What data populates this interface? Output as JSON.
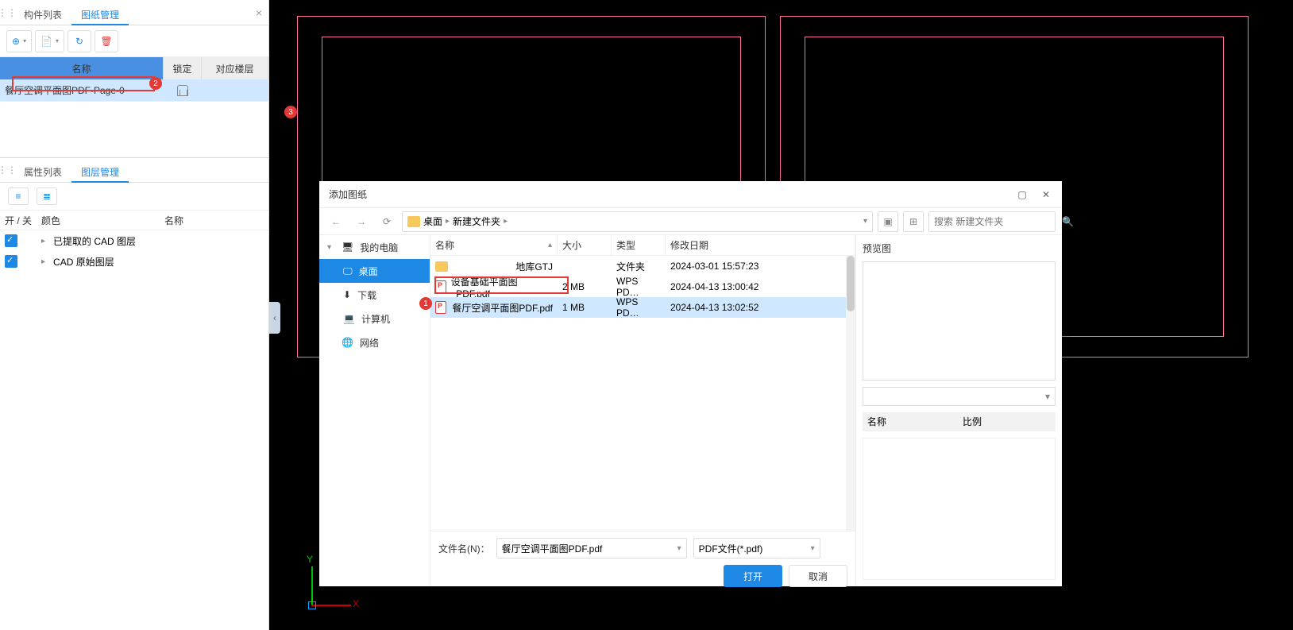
{
  "left": {
    "tabs": [
      "构件列表",
      "图纸管理"
    ],
    "drawingGrid": {
      "headers": {
        "name": "名称",
        "lock": "锁定",
        "floor": "对应楼层"
      },
      "row": {
        "name": "餐厅空调平面图PDF-Page-0"
      }
    },
    "tabs2": [
      "属性列表",
      "图层管理"
    ],
    "layerHeaders": {
      "onoff": "开 / 关",
      "color": "颜色",
      "name": "名称"
    },
    "layers": [
      "已提取的 CAD 图层",
      "CAD 原始图层"
    ]
  },
  "badges": {
    "b1": "1",
    "b2": "2",
    "b3": "3"
  },
  "axis": {
    "x": "X",
    "y": "Y"
  },
  "dialog": {
    "title": "添加图纸",
    "breadcrumb": [
      "桌面",
      "新建文件夹"
    ],
    "searchPlaceholder": "搜索 新建文件夹",
    "tree": {
      "root": "我的电脑",
      "desktop": "桌面",
      "download": "下载",
      "computer": "计算机",
      "network": "网络"
    },
    "columns": {
      "name": "名称",
      "size": "大小",
      "type": "类型",
      "date": "修改日期"
    },
    "files": [
      {
        "name": "地库GTJ",
        "size": "",
        "type": "文件夹",
        "date": "2024-03-01 15:57:23",
        "kind": "folder"
      },
      {
        "name": "设备基础平面图_PDF.pdf",
        "size": "2 MB",
        "type": "WPS PD…",
        "date": "2024-04-13 13:00:42",
        "kind": "pdf"
      },
      {
        "name": "餐厅空调平面图PDF.pdf",
        "size": "1 MB",
        "type": "WPS PD…",
        "date": "2024-04-13 13:02:52",
        "kind": "pdf"
      }
    ],
    "preview": {
      "label": "预览图",
      "ratioHead": {
        "name": "名称",
        "ratio": "比例"
      }
    },
    "footer": {
      "fileNameLabel": "文件名(N)：",
      "fileNameValue": "餐厅空调平面图PDF.pdf",
      "filterValue": "PDF文件(*.pdf)",
      "open": "打开",
      "cancel": "取消"
    }
  }
}
